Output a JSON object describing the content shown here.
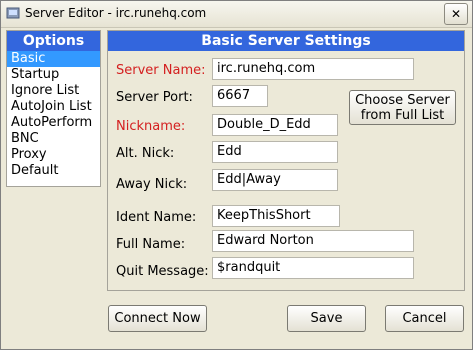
{
  "window": {
    "title": "Server Editor - irc.runehq.com",
    "close_glyph": "✕"
  },
  "options": {
    "header": "Options",
    "items": [
      "Basic",
      "Startup",
      "Ignore List",
      "AutoJoin List",
      "AutoPerform",
      "BNC",
      "Proxy",
      "Default"
    ],
    "selected": "Basic"
  },
  "settings": {
    "header": "Basic Server Settings",
    "server_name": {
      "label": "Server Name:",
      "value": "irc.runehq.com"
    },
    "server_port": {
      "label": "Server Port:",
      "value": "6667"
    },
    "nickname": {
      "label": "Nickname:",
      "value": "Double_D_Edd"
    },
    "alt_nick": {
      "label": "Alt. Nick:",
      "value": "Edd"
    },
    "away_nick": {
      "label": "Away Nick:",
      "value": "Edd|Away"
    },
    "ident_name": {
      "label": "Ident Name:",
      "value": "KeepThisShort"
    },
    "full_name": {
      "label": "Full Name:",
      "value": "Edward Norton"
    },
    "quit_message": {
      "label": "Quit Message:",
      "value": "$randquit"
    },
    "choose_server": {
      "line1": "Choose Server",
      "line2": "from Full List"
    }
  },
  "buttons": {
    "connect_now": "Connect Now",
    "save": "Save",
    "cancel": "Cancel"
  },
  "colors": {
    "header_bg": "#3366dd",
    "selected_bg": "#3399ff",
    "required_label": "#d42020",
    "window_bg": "#ece9d8"
  }
}
